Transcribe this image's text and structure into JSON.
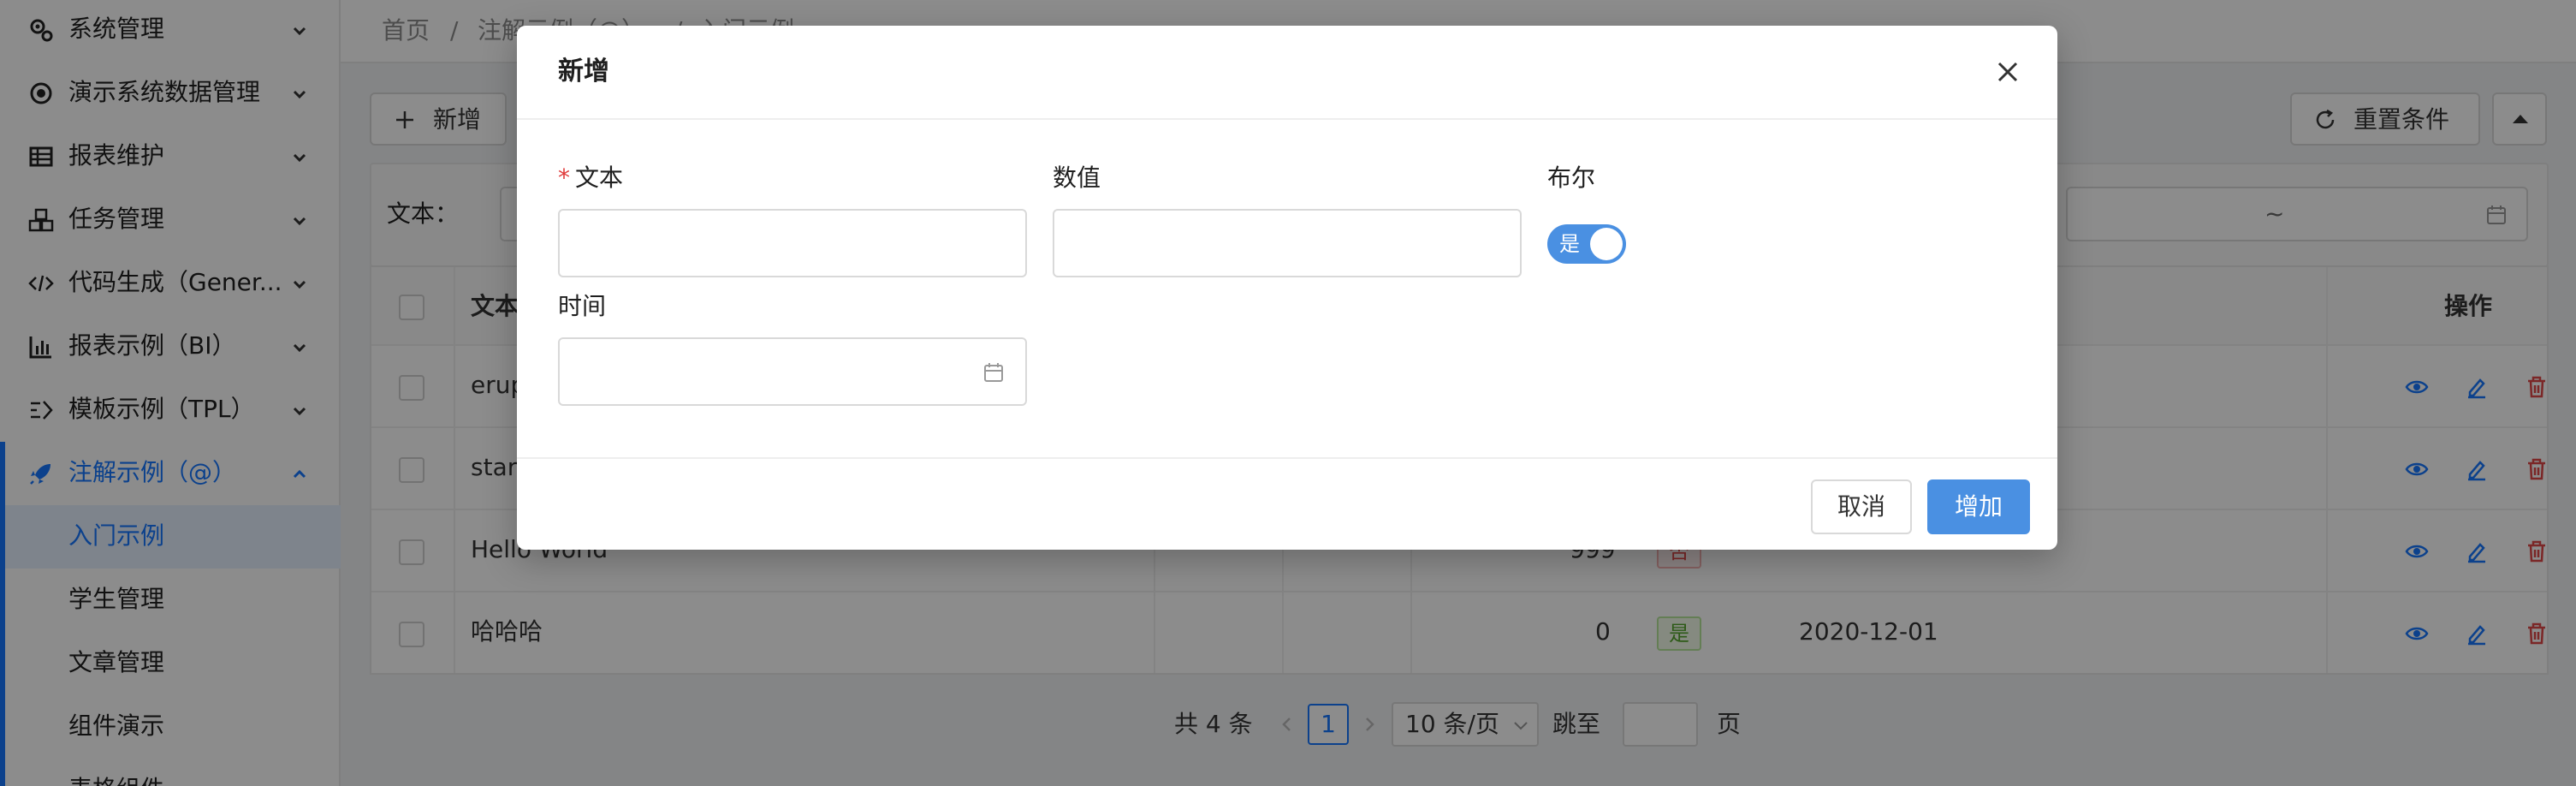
{
  "sidebar": {
    "menus": [
      {
        "label": "系统管理",
        "icon": "gear-icon"
      },
      {
        "label": "演示系统数据管理",
        "icon": "dot-circle-icon"
      },
      {
        "label": "报表维护",
        "icon": "table-icon"
      },
      {
        "label": "任务管理",
        "icon": "cubes-icon"
      },
      {
        "label": "代码生成（Gener...",
        "icon": "code-icon"
      },
      {
        "label": "报表示例（BI）",
        "icon": "bar-chart-icon"
      },
      {
        "label": "模板示例（TPL）",
        "icon": "template-icon"
      },
      {
        "label": "注解示例（@）",
        "icon": "rocket-icon"
      }
    ],
    "submenus": [
      "入门示例",
      "学生管理",
      "文章管理",
      "组件演示",
      "表格组件"
    ]
  },
  "breadcrumb": {
    "home": "首页",
    "sep": "/",
    "section": "注解示例（@）",
    "sep2": "/",
    "page": "入门示例"
  },
  "toolbar": {
    "add_label": "新增",
    "reset_label": "重置条件"
  },
  "search": {
    "text_label": "文本：",
    "range_sep": "~"
  },
  "table": {
    "header_col1": "文本",
    "header_ops": "操作",
    "rows": [
      {
        "text": "erup",
        "number": "",
        "bool": "",
        "time": ""
      },
      {
        "text": "star",
        "number": "",
        "bool": "",
        "time": ""
      },
      {
        "text": "Hello World",
        "number": "999",
        "bool": "否",
        "time": ""
      },
      {
        "text": "哈哈哈",
        "number": "0",
        "bool": "是",
        "time": "2020-12-01"
      }
    ]
  },
  "pagination": {
    "total": "共 4 条",
    "current_page": "1",
    "page_size": "10 条/页",
    "jump_label": "跳至",
    "page_unit": "页"
  },
  "modal": {
    "title": "新增",
    "fields": {
      "text_label": "文本",
      "text_required_mark": "*",
      "number_label": "数值",
      "bool_label": "布尔",
      "bool_value": "是",
      "time_label": "时间"
    },
    "cancel_label": "取消",
    "confirm_label": "增加"
  },
  "colors": {
    "accent": "#1677ff",
    "switch_on": "#4a90e2",
    "required": "#e03a3a",
    "delete": "#e04848"
  }
}
